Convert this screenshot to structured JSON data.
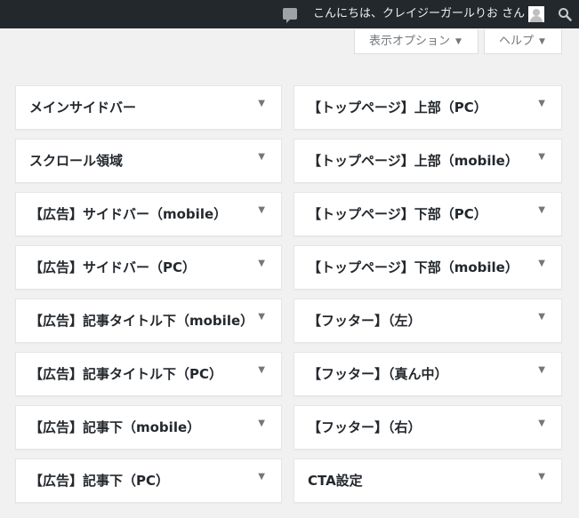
{
  "admin_bar": {
    "greeting": "こんにちは、クレイジーガールりお さん"
  },
  "screen_meta": {
    "screen_options": "表示オプション",
    "help": "ヘルプ",
    "arrow": "▼"
  },
  "widgets": {
    "toggle": "▼",
    "left": [
      "メインサイドバー",
      "スクロール領域",
      "【広告】サイドバー（mobile）",
      "【広告】サイドバー（PC）",
      "【広告】記事タイトル下（mobile）",
      "【広告】記事タイトル下（PC）",
      "【広告】記事下（mobile）",
      "【広告】記事下（PC）"
    ],
    "right": [
      "【トップページ】上部（PC）",
      "【トップページ】上部（mobile）",
      "【トップページ】下部（PC）",
      "【トップページ】下部（mobile）",
      "【フッター】（左）",
      "【フッター】（真ん中）",
      "【フッター】（右）",
      "CTA設定"
    ]
  }
}
